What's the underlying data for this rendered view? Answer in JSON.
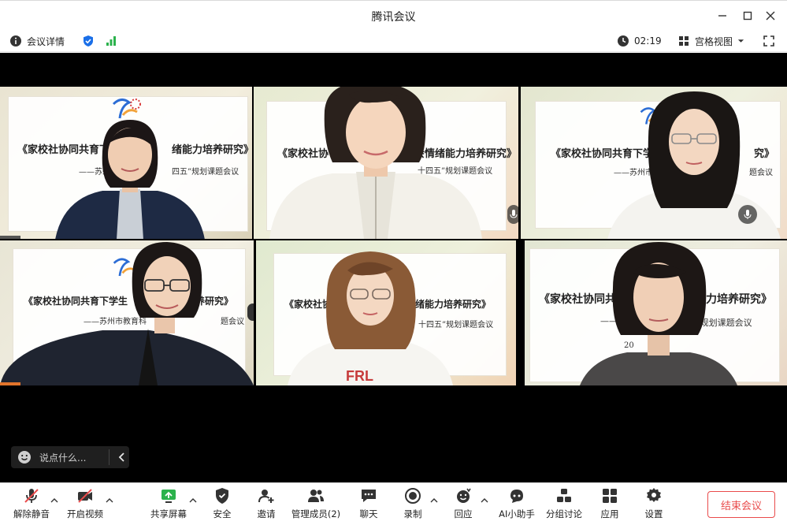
{
  "window": {
    "title": "腾讯会议"
  },
  "infobar": {
    "details_label": "会议详情",
    "timer": "02:19",
    "view_label": "宫格视图"
  },
  "slide": {
    "title_full": "《家校社协同共育下学生社会情绪能力培养研究》",
    "title_t1": "《家校社协同共育下学生",
    "title_t1b": "绪能力培养研究》",
    "title_t2a": "《家校社协",
    "title_t2b": "生社会情绪能力培养研究》",
    "title_t3a": "《家校社协同共育下学",
    "title_t3b": "究》",
    "title_t4a": "《家校社协同共育下学生",
    "title_t4b": "养研究》",
    "title_t5a": "《家校社协同共",
    "title_t5b": "情绪能力培养研究》",
    "title_t6a": "《家校社协同共",
    "title_t6b": "能力培养研究》",
    "sub_t1a": "——苏州市",
    "sub_t1b": "四五”规划课题会议",
    "sub_t2": "十四五”规划课题会议",
    "sub_t3a": "——苏州市教",
    "sub_t3b": "题会议",
    "sub_t4a": "——苏州市教育科",
    "sub_t4b": "题会议",
    "sub_t5": "十四五”规划课题会议",
    "sub_t6a": "——",
    "sub_t6b": "五”规划课题会议",
    "year_t6": "20"
  },
  "chat": {
    "placeholder": "说点什么..."
  },
  "toolbar": {
    "mute": "解除静音",
    "video": "开启视频",
    "share": "共享屏幕",
    "security": "安全",
    "invite": "邀请",
    "members": "管理成员(2)",
    "chat": "聊天",
    "record": "录制",
    "reply": "回应",
    "ai": "AI小助手",
    "breakout": "分组讨论",
    "apps": "应用",
    "settings": "设置",
    "end": "结束会议"
  },
  "colors": {
    "accent_green": "#2bb24c",
    "end_red": "#e94b4b",
    "shield_blue": "#1a6fe8"
  }
}
